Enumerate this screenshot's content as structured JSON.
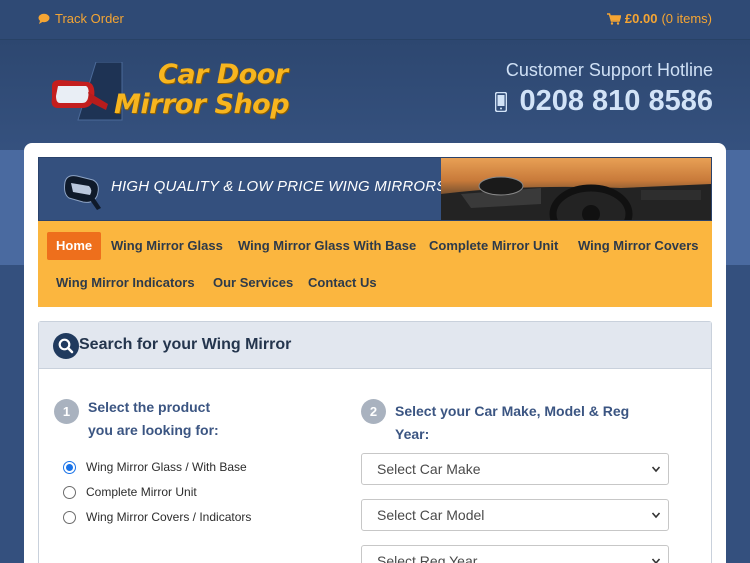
{
  "topbar": {
    "track_order": "Track Order",
    "cart_total": "£0.00",
    "cart_items": "(0 items)",
    "icons": [
      "chat-icon",
      "cart-icon"
    ]
  },
  "header": {
    "logo_line1": "Car Door",
    "logo_line2": "Mirror Shop",
    "support_title": "Customer Support Hotline",
    "phone": "0208 810 8586"
  },
  "banner": {
    "text": "HIGH QUALITY & LOW PRICE WING MIRRORS"
  },
  "nav": {
    "items": [
      {
        "label": "Home",
        "active": true
      },
      {
        "label": "Wing Mirror Glass"
      },
      {
        "label": "Wing Mirror Glass With Base"
      },
      {
        "label": "Complete Mirror Unit"
      },
      {
        "label": "Wing Mirror Covers"
      },
      {
        "label": "Wing Mirror Indicators"
      },
      {
        "label": "Our Services"
      },
      {
        "label": "Contact Us"
      }
    ]
  },
  "search": {
    "title": "Search for your Wing Mirror",
    "step1": {
      "number": "1",
      "label_line1": "Select the product",
      "label_line2": "you are looking for:",
      "options": [
        {
          "label": "Wing Mirror Glass / With Base",
          "checked": true
        },
        {
          "label": "Complete Mirror Unit",
          "checked": false
        },
        {
          "label": "Wing Mirror Covers / Indicators",
          "checked": false
        }
      ]
    },
    "step2": {
      "number": "2",
      "label_line1": "Select your Car Make, Model & Reg",
      "label_line2": "Year:",
      "selects": [
        "Select Car Make",
        "Select Car Model",
        "Select Reg Year"
      ]
    }
  },
  "colors": {
    "accent_orange": "#fbb63f",
    "active_tab": "#ee6f1c",
    "brand_blue": "#34507e",
    "logo_yellow": "#f7b51f"
  }
}
